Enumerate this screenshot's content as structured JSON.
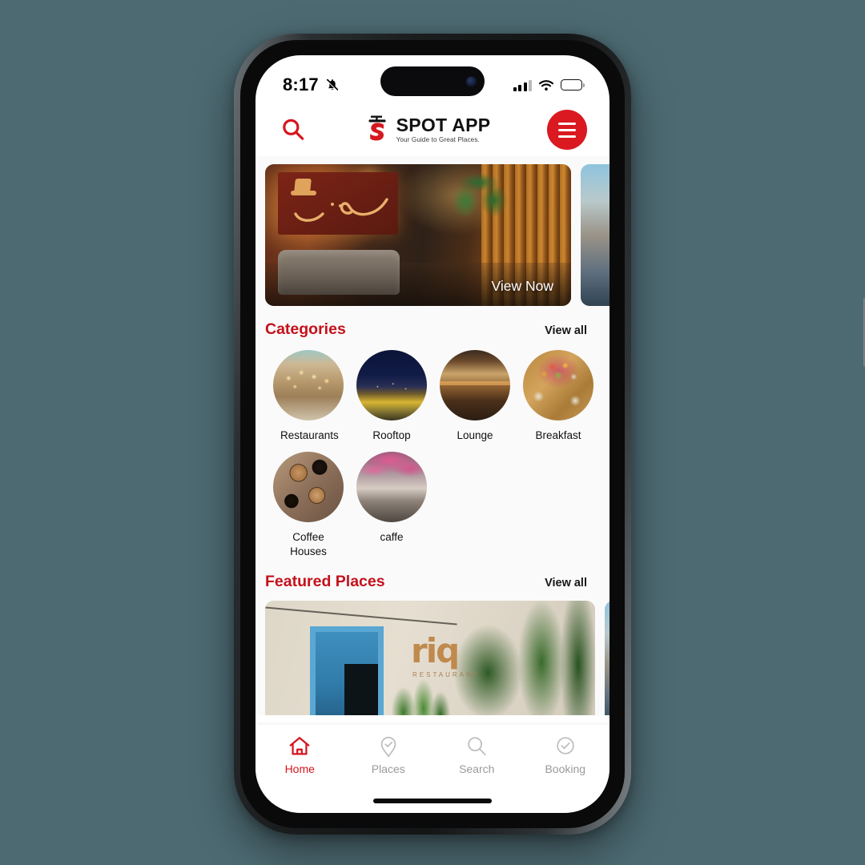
{
  "status_bar": {
    "time": "8:17",
    "bell_icon": "bell-muted-icon",
    "signal_icon": "cellular-signal-icon",
    "wifi_icon": "wifi-icon",
    "battery_icon": "battery-low-icon"
  },
  "header": {
    "search_icon": "search-icon",
    "brand_name": "SPOT APP",
    "brand_tagline": "Your Guide to Great Places.",
    "brand_mark": "spot-s-logo-icon",
    "menu_icon": "hamburger-menu-icon"
  },
  "hero": {
    "cta_label": "View Now",
    "cards": [
      {
        "name": "restaurant-interior-arabic-sign"
      },
      {
        "name": "next-place-preview"
      }
    ]
  },
  "categories_section": {
    "title": "Categories",
    "view_all_label": "View all",
    "items": [
      {
        "label": "Restaurants",
        "art": "art-restaurants"
      },
      {
        "label": "Rooftop",
        "art": "art-rooftop"
      },
      {
        "label": "Lounge",
        "art": "art-lounge"
      },
      {
        "label": "Breakfast",
        "art": "art-breakfast"
      },
      {
        "label": "Coffee Houses",
        "art": "art-coffee"
      },
      {
        "label": "caffe",
        "art": "art-caffe"
      }
    ]
  },
  "featured_section": {
    "title": "Featured Places",
    "view_all_label": "View all",
    "cards": [
      {
        "name": "riq-restaurant",
        "sign_text": "riq",
        "sign_sub": "RESTAURANT"
      },
      {
        "name": "next-featured-preview"
      }
    ]
  },
  "bottom_nav": {
    "items": [
      {
        "label": "Home",
        "icon": "home-icon",
        "active": true
      },
      {
        "label": "Places",
        "icon": "map-pin-check-icon",
        "active": false
      },
      {
        "label": "Search",
        "icon": "search-icon",
        "active": false
      },
      {
        "label": "Booking",
        "icon": "circle-check-icon",
        "active": false
      }
    ]
  },
  "colors": {
    "brand_red": "#da1921",
    "section_red": "#c4111b",
    "active_nav_red": "#d5151d",
    "inactive_nav_gray": "#9a9a9a",
    "page_background": "#4d6a72",
    "app_background": "#fafafa"
  }
}
